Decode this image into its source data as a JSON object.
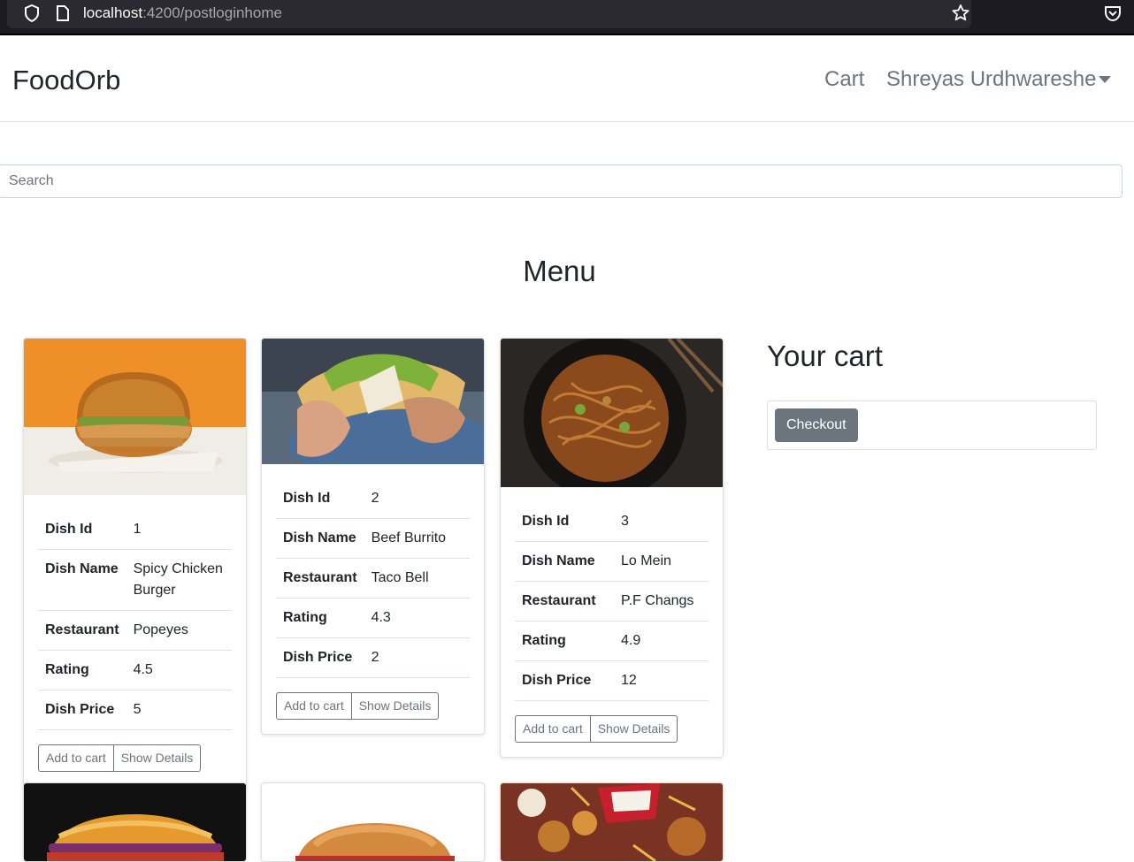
{
  "browser": {
    "url_host": "localhost",
    "url_path": ":4200/postloginhome"
  },
  "navbar": {
    "brand": "FoodOrb",
    "cart_link": "Cart",
    "user_name": "Shreyas Urdhwareshe"
  },
  "search": {
    "placeholder": "Search",
    "value": ""
  },
  "menu": {
    "title": "Menu",
    "labels": {
      "dish_id": "Dish Id",
      "dish_name": "Dish Name",
      "restaurant": "Restaurant",
      "rating": "Rating",
      "dish_price": "Dish Price",
      "add_to_cart": "Add to cart",
      "show_details": "Show Details"
    },
    "dishes": [
      {
        "id": "1",
        "name": "Spicy Chicken Burger",
        "restaurant": "Popeyes",
        "rating": "4.5",
        "price": "5"
      },
      {
        "id": "2",
        "name": "Beef Burrito",
        "restaurant": "Taco Bell",
        "rating": "4.3",
        "price": "2"
      },
      {
        "id": "3",
        "name": "Lo Mein",
        "restaurant": "P.F Changs",
        "rating": "4.9",
        "price": "12"
      }
    ]
  },
  "cart": {
    "title": "Your cart",
    "checkout_label": "Checkout"
  }
}
